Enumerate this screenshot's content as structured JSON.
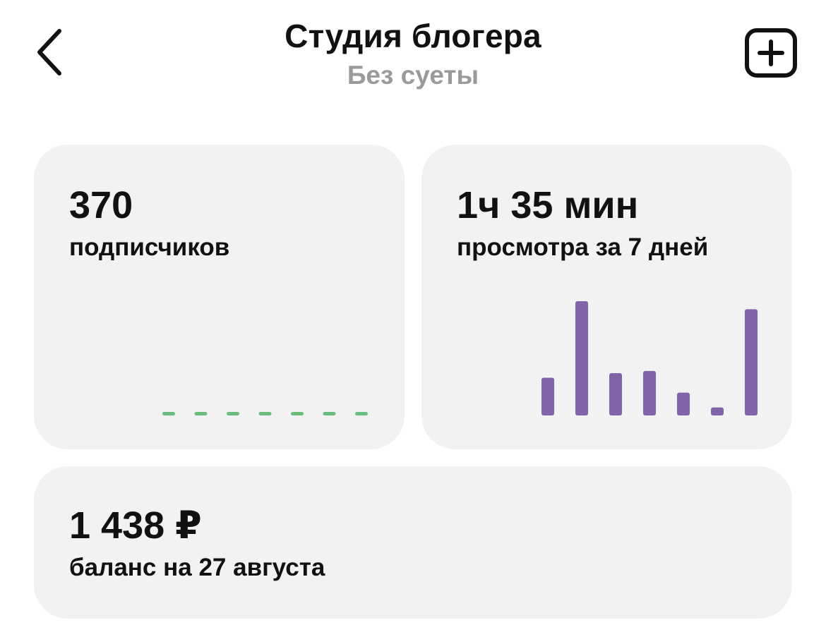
{
  "header": {
    "title": "Студия блогера",
    "subtitle": "Без суеты",
    "back_icon": "chevron-left-icon",
    "add_icon": "plus-square-icon"
  },
  "subscribers": {
    "value": "370",
    "label": "подписчиков",
    "chart_data": {
      "type": "bar",
      "values": [
        0,
        0,
        0,
        0,
        0,
        0,
        0
      ],
      "ylim": [
        0,
        1
      ],
      "color": "#6bbd7c"
    }
  },
  "views": {
    "value": "1ч 35 мин",
    "label": "просмотра за 7 дней",
    "chart_data": {
      "type": "bar",
      "values": [
        0.33,
        1.0,
        0.37,
        0.39,
        0.2,
        0.07,
        0.93
      ],
      "ylim": [
        0,
        1
      ],
      "color": "#8063a8"
    }
  },
  "balance": {
    "value": "1 438 ₽",
    "label": "баланс на 27 августа"
  },
  "colors": {
    "card_background": "#f2f2f2",
    "subtitle": "#9a9a9a",
    "text": "#111111"
  }
}
